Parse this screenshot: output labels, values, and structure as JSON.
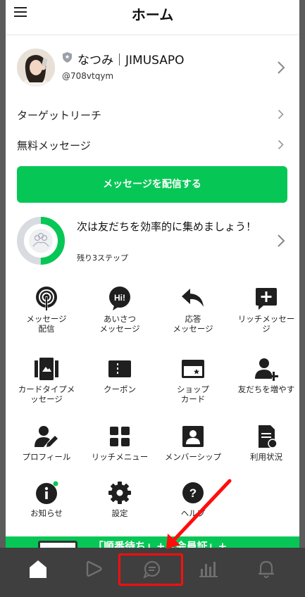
{
  "header": {
    "title": "ホーム"
  },
  "profile": {
    "name": "なつみ｜JIMUSAPO",
    "id": "@708vtqym"
  },
  "menu_rows": [
    {
      "label": "ターゲットリーチ"
    },
    {
      "label": "無料メッセージ"
    }
  ],
  "primary_button": {
    "label": "メッセージを配信する"
  },
  "steps": {
    "title": "次は友だちを効率的に集めましょう！",
    "sub": "残り3ステップ",
    "progress": 0.5
  },
  "features": [
    {
      "label": "メッセージ\n配信",
      "icon": "broadcast-icon"
    },
    {
      "label": "あいさつ\nメッセージ",
      "icon": "hi-bubble-icon"
    },
    {
      "label": "応答\nメッセージ",
      "icon": "reply-icon"
    },
    {
      "label": "リッチメッセー\nジ",
      "icon": "rich-message-icon"
    },
    {
      "label": "カードタイプメ\nッセージ",
      "icon": "card-type-icon"
    },
    {
      "label": "クーポン",
      "icon": "coupon-icon"
    },
    {
      "label": "ショップ\nカード",
      "icon": "shop-card-icon"
    },
    {
      "label": "友だちを増やす",
      "icon": "add-friend-icon"
    },
    {
      "label": "プロフィール",
      "icon": "profile-edit-icon"
    },
    {
      "label": "リッチメニュー",
      "icon": "rich-menu-icon"
    },
    {
      "label": "メンバーシップ",
      "icon": "membership-icon"
    },
    {
      "label": "利用状況",
      "icon": "usage-icon"
    },
    {
      "label": "お知らせ",
      "icon": "info-icon"
    },
    {
      "label": "設定",
      "icon": "gear-icon"
    },
    {
      "label": "ヘルプ",
      "icon": "help-icon"
    }
  ],
  "banner": {
    "text": "「順番待ち」+「会員証」+"
  },
  "tabs": [
    {
      "name": "home-tab",
      "icon": "home-icon"
    },
    {
      "name": "timeline-tab",
      "icon": "play-icon"
    },
    {
      "name": "chat-tab",
      "icon": "chat-icon"
    },
    {
      "name": "analytics-tab",
      "icon": "bar-chart-icon"
    },
    {
      "name": "notifications-tab",
      "icon": "bell-icon"
    }
  ],
  "colors": {
    "accent": "#06c755",
    "highlight": "#ff0d0d",
    "tabbar": "#3f3f3f"
  }
}
